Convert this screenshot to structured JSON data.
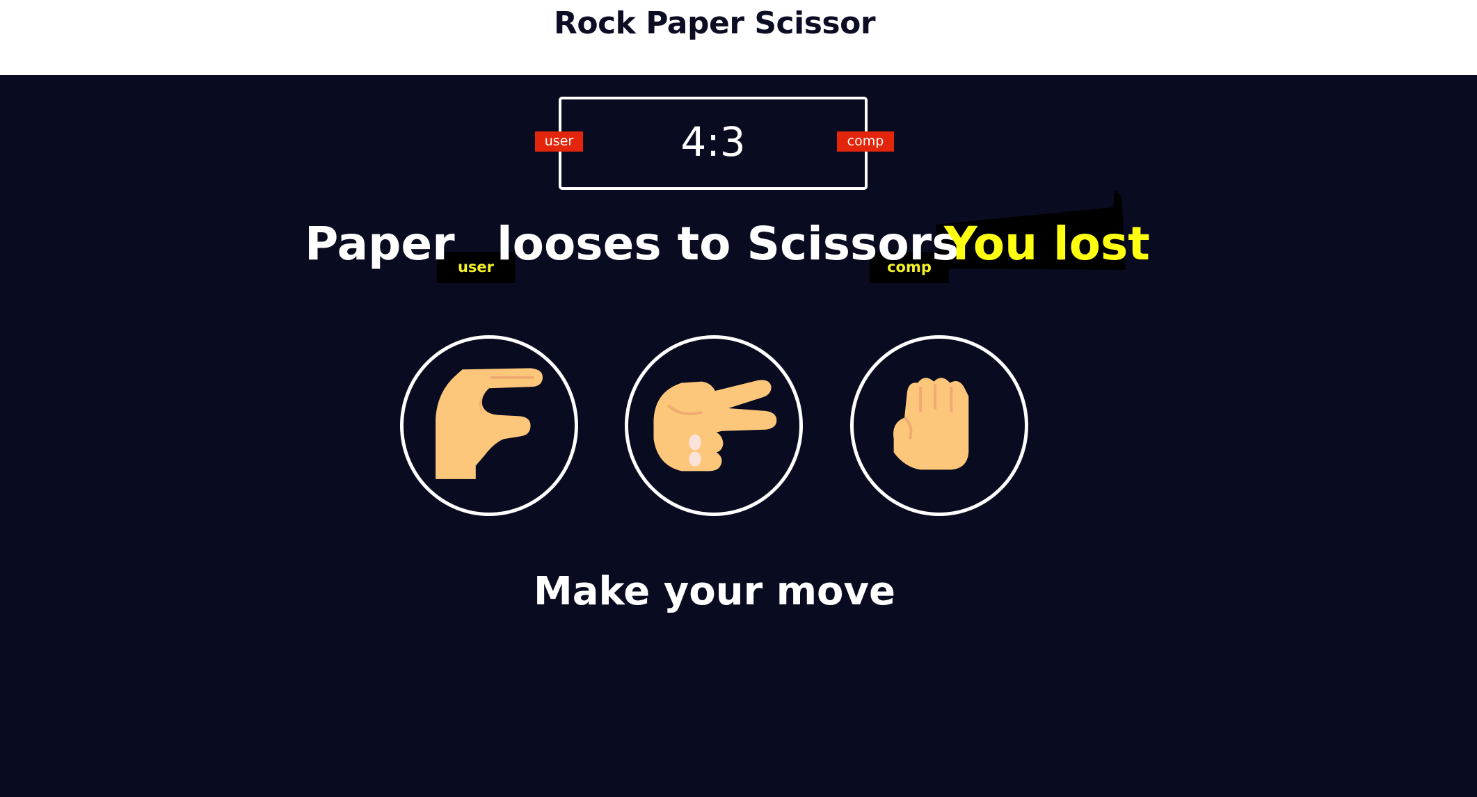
{
  "header": {
    "title": "Rock Paper Scissor"
  },
  "scoreboard": {
    "score": "4:3",
    "user_label": "user",
    "comp_label": "comp"
  },
  "result": {
    "user_choice": "Paper",
    "user_tag": "user",
    "verb_text": "looses to Scissors",
    "comp_tag": "comp",
    "outcome": "You lost"
  },
  "choices": [
    {
      "name": "paper",
      "icon": "paper-hand-icon"
    },
    {
      "name": "scissors",
      "icon": "scissors-hand-icon"
    },
    {
      "name": "rock",
      "icon": "rock-fist-icon"
    }
  ],
  "prompt": "Make your move",
  "colors": {
    "background": "#090b20",
    "header_bg": "#ffffff",
    "badge": "#e2250b",
    "highlight": "#ffff11",
    "skin": "#fcc77b",
    "skin_shadow": "#f0a970"
  }
}
